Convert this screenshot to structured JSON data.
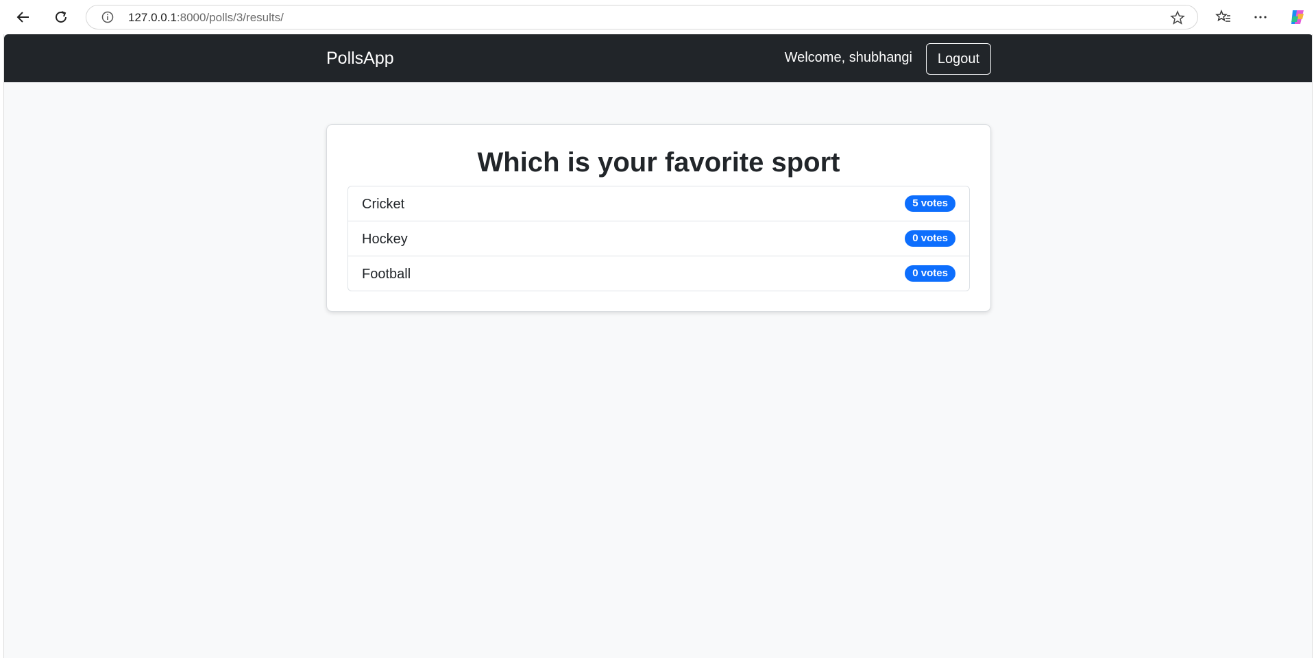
{
  "browser": {
    "url_host": "127.0.0.1",
    "url_path": ":8000/polls/3/results/",
    "icons": [
      "back-arrow-icon",
      "reload-icon",
      "info-icon",
      "star-icon",
      "favorites-icon",
      "more-icon",
      "copilot-icon"
    ]
  },
  "navbar": {
    "brand": "PollsApp",
    "welcome": "Welcome, shubhangi",
    "logout_label": "Logout",
    "background": "#212529"
  },
  "poll": {
    "question": "Which is your favorite sport",
    "choices": [
      {
        "label": "Cricket",
        "votes": "5 votes"
      },
      {
        "label": "Hockey",
        "votes": "0 votes"
      },
      {
        "label": "Football",
        "votes": "0 votes"
      }
    ],
    "badge_color": "#0d6efd"
  }
}
